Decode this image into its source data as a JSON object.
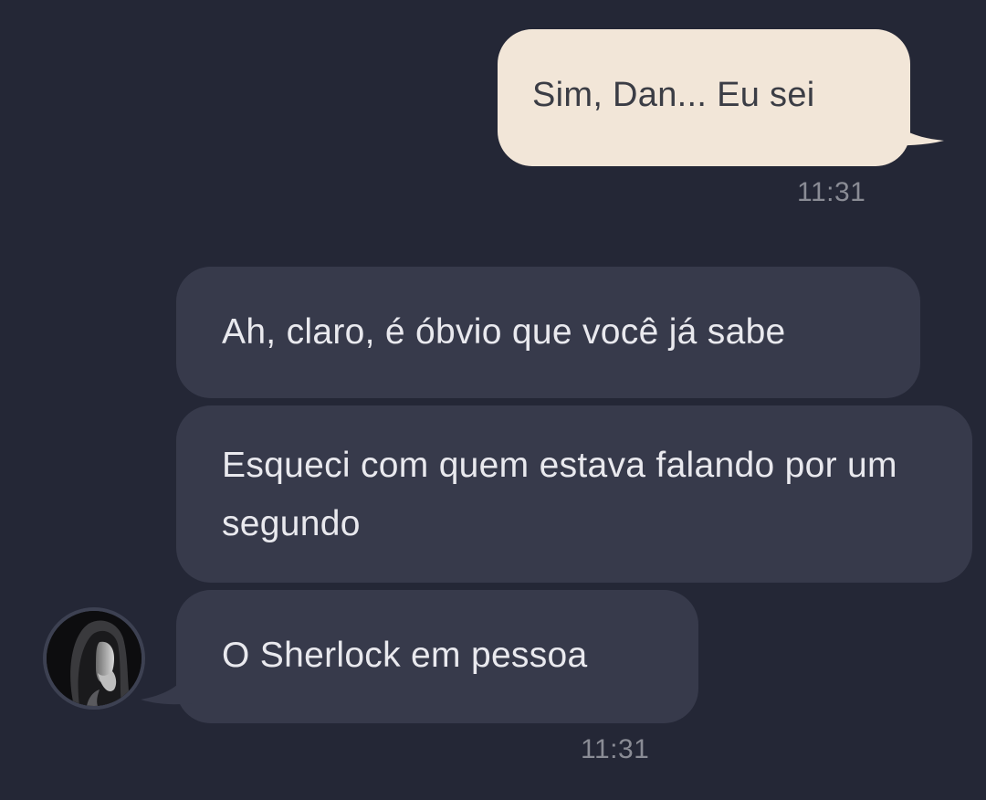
{
  "colors": {
    "background": "#242736",
    "outgoing_bubble": "#f2e6d8",
    "incoming_bubble": "#373a4b",
    "timestamp": "#8a8c95"
  },
  "messages": {
    "outgoing": [
      {
        "text": "Sim, Dan... Eu sei"
      }
    ],
    "outgoing_time": "11:31",
    "incoming": [
      {
        "text": "Ah, claro, é óbvio que você já sabe"
      },
      {
        "text": "Esqueci com quem estava falando por um segundo"
      },
      {
        "text": "O Sherlock em pessoa"
      }
    ],
    "incoming_time": "11:31"
  },
  "contact": {
    "avatar_icon": "hooded-person-avatar-icon"
  }
}
